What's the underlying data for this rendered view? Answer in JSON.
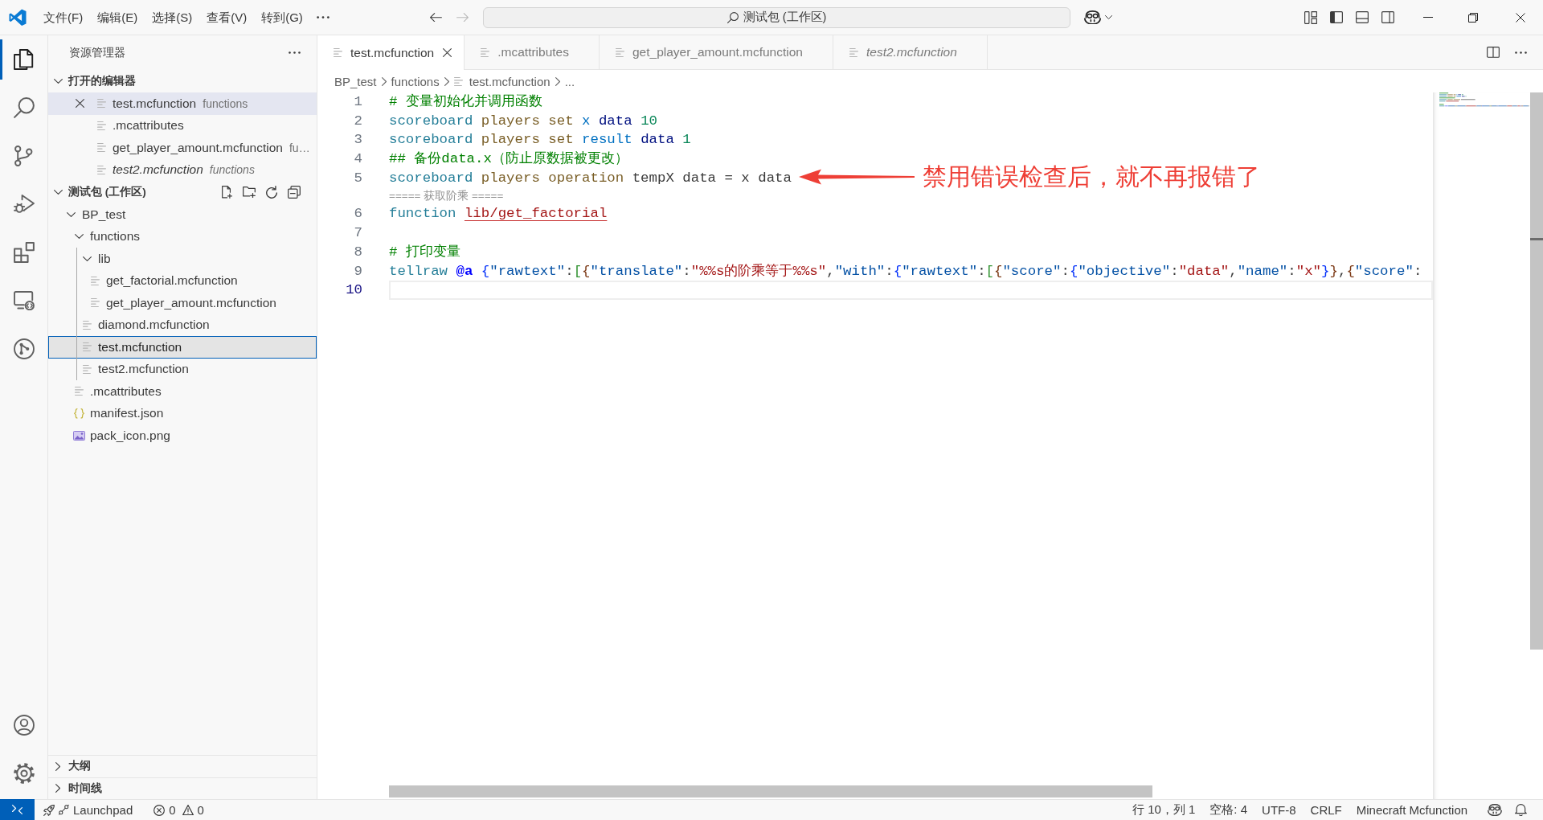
{
  "title_bar": {
    "menus": [
      "文件(F)",
      "编辑(E)",
      "选择(S)",
      "查看(V)",
      "转到(G)"
    ],
    "navigation": [
      {
        "kind": "back",
        "disabled": false
      },
      {
        "kind": "forward",
        "disabled": true
      }
    ],
    "search": {
      "value": "测试包 (工作区)"
    },
    "layout_toggles": [
      {
        "kind": "primary_sidebar",
        "on": true
      },
      {
        "kind": "panel",
        "on": false
      },
      {
        "kind": "secondary_sidebar",
        "on": false
      }
    ]
  },
  "activity_bar": {
    "items": [
      {
        "kind": "explorer",
        "selected": true
      },
      {
        "kind": "search",
        "selected": false
      },
      {
        "kind": "source_control",
        "selected": false
      },
      {
        "kind": "run_debug",
        "selected": false
      },
      {
        "kind": "extensions",
        "selected": false
      },
      {
        "kind": "remote_explorer",
        "selected": false
      },
      {
        "kind": "git_graph",
        "selected": false
      }
    ],
    "bottom": [
      {
        "kind": "account"
      },
      {
        "kind": "settings"
      }
    ]
  },
  "sidebar": {
    "title": "资源管理器",
    "open_editors": {
      "title": "打开的编辑器",
      "expanded": true,
      "items": [
        {
          "name": "test.mcfunction",
          "description": "functions",
          "selected": true,
          "preview": false
        },
        {
          "name": ".mcattributes",
          "selected": false,
          "preview": false
        },
        {
          "name": "get_player_amount.mcfunction",
          "description": "fu…",
          "selected": false,
          "preview": false
        },
        {
          "name": "test2.mcfunction",
          "description": "functions",
          "selected": false,
          "preview": true
        }
      ]
    },
    "workspace": {
      "title": "测试包 (工作区)",
      "expanded": true,
      "tree": [
        {
          "name": "BP_test",
          "kind": "folder",
          "expanded": true,
          "selected": false,
          "children": [
            {
              "name": "functions",
              "kind": "folder",
              "expanded": true,
              "selected": false,
              "children": [
                {
                  "name": "lib",
                  "kind": "folder",
                  "expanded": true,
                  "selected": false,
                  "children": [
                    {
                      "name": "get_factorial.mcfunction",
                      "kind": "file",
                      "selected": false
                    },
                    {
                      "name": "get_player_amount.mcfunction",
                      "kind": "file",
                      "selected": false
                    }
                  ]
                },
                {
                  "name": "diamond.mcfunction",
                  "kind": "file",
                  "selected": false
                },
                {
                  "name": "test.mcfunction",
                  "kind": "file",
                  "selected": true
                },
                {
                  "name": "test2.mcfunction",
                  "kind": "file",
                  "selected": false
                }
              ]
            },
            {
              "name": ".mcattributes",
              "kind": "file",
              "selected": false
            },
            {
              "name": "manifest.json",
              "kind": "json",
              "selected": false
            },
            {
              "name": "pack_icon.png",
              "kind": "image",
              "selected": false
            }
          ]
        }
      ]
    },
    "bottom_sections": [
      {
        "title": "大纲",
        "expanded": false
      },
      {
        "title": "时间线",
        "expanded": false
      }
    ]
  },
  "editor": {
    "tabs": [
      {
        "label": "test.mcfunction",
        "selected": true,
        "preview": false
      },
      {
        "label": ".mcattributes",
        "selected": false,
        "preview": false
      },
      {
        "label": "get_player_amount.mcfunction",
        "selected": false,
        "preview": false
      },
      {
        "label": "test2.mcfunction",
        "selected": false,
        "preview": true
      }
    ],
    "breadcrumbs": [
      {
        "label": "BP_test",
        "kind": "folder"
      },
      {
        "label": "functions",
        "kind": "folder"
      },
      {
        "label": "test.mcfunction",
        "kind": "file"
      },
      {
        "label": "...",
        "kind": "symbol"
      }
    ],
    "lines": [
      {
        "number": "1",
        "selected": false,
        "tokens": [
          {
            "text": "# 变量初始化并调用函数",
            "kind": "comment"
          }
        ]
      },
      {
        "number": "2",
        "selected": false,
        "tokens": [
          {
            "text": "scoreboard ",
            "kind": "command"
          },
          {
            "text": "players ",
            "kind": "subcommand"
          },
          {
            "text": "set ",
            "kind": "subcommand"
          },
          {
            "text": "x ",
            "kind": "target"
          },
          {
            "text": "data ",
            "kind": "objective"
          },
          {
            "text": "10",
            "kind": "number"
          }
        ]
      },
      {
        "number": "3",
        "selected": false,
        "tokens": [
          {
            "text": "scoreboard ",
            "kind": "command"
          },
          {
            "text": "players ",
            "kind": "subcommand"
          },
          {
            "text": "set ",
            "kind": "subcommand"
          },
          {
            "text": "result ",
            "kind": "target"
          },
          {
            "text": "data ",
            "kind": "objective"
          },
          {
            "text": "1",
            "kind": "number"
          }
        ]
      },
      {
        "number": "4",
        "selected": false,
        "tokens": [
          {
            "text": "## 备份data.x（防止原数据被更改）",
            "kind": "comment"
          }
        ]
      },
      {
        "number": "5",
        "selected": false,
        "tokens": [
          {
            "text": "scoreboard ",
            "kind": "command"
          },
          {
            "text": "players ",
            "kind": "subcommand"
          },
          {
            "text": "operation ",
            "kind": "subcommand"
          },
          {
            "text": "tempX data = x data",
            "kind": "plain"
          }
        ]
      },
      {
        "number": "6",
        "selected": false,
        "codelens": "===== 获取阶乘 =====",
        "tokens": [
          {
            "text": "function ",
            "kind": "command"
          },
          {
            "text": "lib/get_factorial",
            "kind": "path"
          }
        ]
      },
      {
        "number": "7",
        "selected": false
      },
      {
        "number": "8",
        "selected": false,
        "tokens": [
          {
            "text": "# 打印变量",
            "kind": "comment"
          }
        ]
      },
      {
        "number": "9",
        "selected": false,
        "tokens": [
          {
            "text": "tellraw ",
            "kind": "command"
          },
          {
            "text": "@a ",
            "kind": "selector"
          },
          {
            "text": "{",
            "kind": "bracket1"
          },
          {
            "text": "\"rawtext\"",
            "kind": "key"
          },
          {
            "text": ":",
            "kind": "punct"
          },
          {
            "text": "[",
            "kind": "bracket2"
          },
          {
            "text": "{",
            "kind": "bracket3"
          },
          {
            "text": "\"translate\"",
            "kind": "key"
          },
          {
            "text": ":",
            "kind": "punct"
          },
          {
            "text": "\"%%s的阶乘等于%%s\"",
            "kind": "string"
          },
          {
            "text": ",",
            "kind": "punct"
          },
          {
            "text": "\"with\"",
            "kind": "key"
          },
          {
            "text": ":",
            "kind": "punct"
          },
          {
            "text": "{",
            "kind": "bracket1"
          },
          {
            "text": "\"rawtext\"",
            "kind": "key"
          },
          {
            "text": ":",
            "kind": "punct"
          },
          {
            "text": "[",
            "kind": "bracket2"
          },
          {
            "text": "{",
            "kind": "bracket3"
          },
          {
            "text": "\"score\"",
            "kind": "key"
          },
          {
            "text": ":",
            "kind": "punct"
          },
          {
            "text": "{",
            "kind": "bracket1"
          },
          {
            "text": "\"objective\"",
            "kind": "key"
          },
          {
            "text": ":",
            "kind": "punct"
          },
          {
            "text": "\"data\"",
            "kind": "string"
          },
          {
            "text": ",",
            "kind": "punct"
          },
          {
            "text": "\"name\"",
            "kind": "key"
          },
          {
            "text": ":",
            "kind": "punct"
          },
          {
            "text": "\"x\"",
            "kind": "string"
          },
          {
            "text": "}",
            "kind": "bracket1"
          },
          {
            "text": "}",
            "kind": "bracket3"
          },
          {
            "text": ",",
            "kind": "punct"
          },
          {
            "text": "{",
            "kind": "bracket3"
          },
          {
            "text": "\"score\"",
            "kind": "key"
          },
          {
            "text": ":",
            "kind": "punct"
          }
        ]
      },
      {
        "number": "10",
        "selected": true
      }
    ],
    "annotation": {
      "text": "禁用错误检查后，就不再报错了"
    }
  },
  "status_bar": {
    "launchpad": "Launchpad",
    "problems": {
      "errors": "0",
      "warnings": "0"
    },
    "right": [
      "行 10，列 1",
      "空格: 4",
      "UTF-8",
      "CRLF",
      "Minecraft Mcfunction"
    ]
  }
}
